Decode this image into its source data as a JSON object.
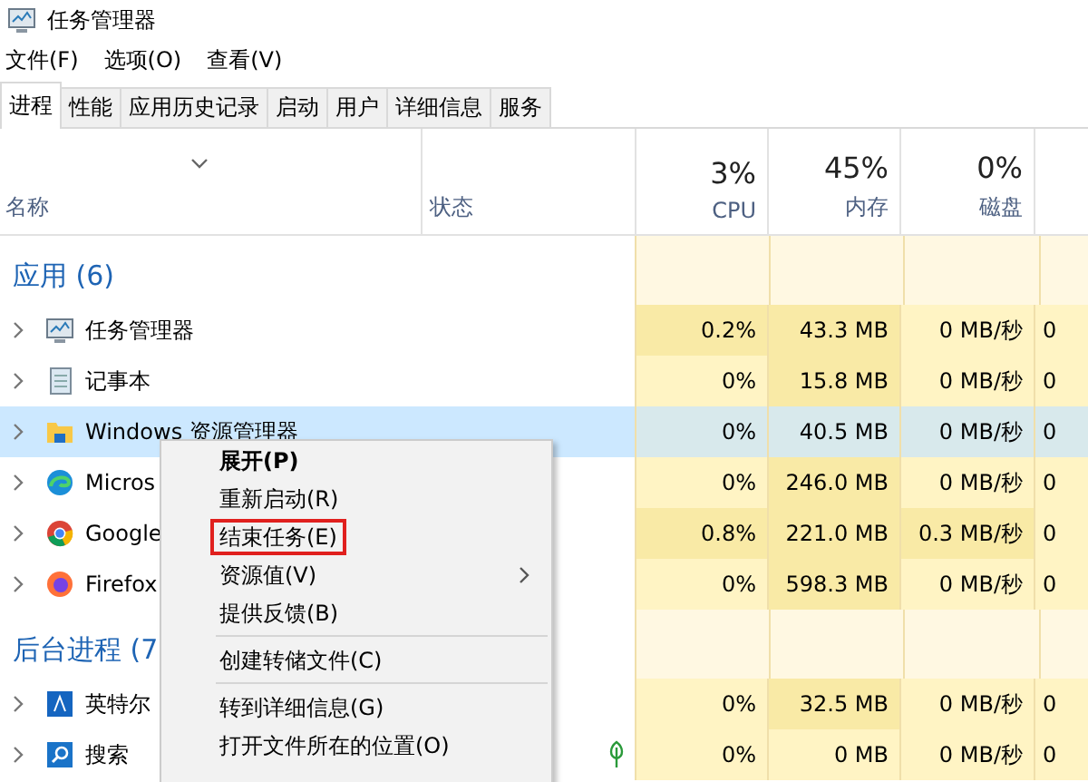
{
  "window": {
    "title": "任务管理器"
  },
  "menu": [
    "文件(F)",
    "选项(O)",
    "查看(V)"
  ],
  "tabs": [
    {
      "label": "进程",
      "selected": true
    },
    {
      "label": "性能",
      "selected": false
    },
    {
      "label": "应用历史记录",
      "selected": false
    },
    {
      "label": "启动",
      "selected": false
    },
    {
      "label": "用户",
      "selected": false
    },
    {
      "label": "详细信息",
      "selected": false
    },
    {
      "label": "服务",
      "selected": false
    }
  ],
  "columns": [
    {
      "label": "名称"
    },
    {
      "label": "状态"
    },
    {
      "percent": "3%",
      "label": "CPU"
    },
    {
      "percent": "45%",
      "label": "内存"
    },
    {
      "percent": "0%",
      "label": "磁盘"
    }
  ],
  "groups": [
    {
      "label": "应用 (6)",
      "rows": [
        {
          "name": "任务管理器",
          "selected": false,
          "eco": false,
          "cells": [
            {
              "text": "0.2%",
              "hot": true
            },
            {
              "text": "43.3 MB",
              "hot": true
            },
            {
              "text": "0 MB/秒",
              "hot": false
            },
            {
              "text": "0",
              "hot": false
            }
          ]
        },
        {
          "name": "记事本",
          "selected": false,
          "eco": false,
          "cells": [
            {
              "text": "0%",
              "hot": false
            },
            {
              "text": "15.8 MB",
              "hot": true
            },
            {
              "text": "0 MB/秒",
              "hot": false
            },
            {
              "text": "0",
              "hot": false
            }
          ]
        },
        {
          "name": "Windows 资源管理器",
          "selected": true,
          "eco": false,
          "cells": [
            {
              "text": "0%",
              "hot": false
            },
            {
              "text": "40.5 MB",
              "hot": false
            },
            {
              "text": "0 MB/秒",
              "hot": false
            },
            {
              "text": "0",
              "hot": false
            }
          ]
        },
        {
          "name": "Micros",
          "selected": false,
          "eco": false,
          "cells": [
            {
              "text": "0%",
              "hot": false
            },
            {
              "text": "246.0 MB",
              "hot": true
            },
            {
              "text": "0 MB/秒",
              "hot": false
            },
            {
              "text": "0",
              "hot": false
            }
          ]
        },
        {
          "name": "Google",
          "selected": false,
          "eco": false,
          "cells": [
            {
              "text": "0.8%",
              "hot": true
            },
            {
              "text": "221.0 MB",
              "hot": true
            },
            {
              "text": "0.3 MB/秒",
              "hot": true
            },
            {
              "text": "0",
              "hot": false
            }
          ]
        },
        {
          "name": "Firefox",
          "selected": false,
          "eco": false,
          "cells": [
            {
              "text": "0%",
              "hot": false
            },
            {
              "text": "598.3 MB",
              "hot": true
            },
            {
              "text": "0 MB/秒",
              "hot": false
            },
            {
              "text": "0",
              "hot": false
            }
          ]
        }
      ]
    },
    {
      "label": "后台进程 (7",
      "rows": [
        {
          "name": "英特尔",
          "selected": false,
          "eco": false,
          "cells": [
            {
              "text": "0%",
              "hot": false
            },
            {
              "text": "32.5 MB",
              "hot": true
            },
            {
              "text": "0 MB/秒",
              "hot": false
            },
            {
              "text": "0",
              "hot": false
            }
          ]
        },
        {
          "name": "搜索",
          "selected": false,
          "eco": true,
          "cells": [
            {
              "text": "0%",
              "hot": false
            },
            {
              "text": "0 MB",
              "hot": false
            },
            {
              "text": "0 MB/秒",
              "hot": false
            },
            {
              "text": "0",
              "hot": false
            }
          ]
        }
      ]
    }
  ],
  "context_menu": [
    {
      "kind": "item",
      "label": "展开(P)",
      "bold": true,
      "outlined": false,
      "submenu": false
    },
    {
      "kind": "item",
      "label": "重新启动(R)",
      "bold": false,
      "outlined": false,
      "submenu": false
    },
    {
      "kind": "item",
      "label": "结束任务(E)",
      "bold": false,
      "outlined": true,
      "submenu": false
    },
    {
      "kind": "item",
      "label": "资源值(V)",
      "bold": false,
      "outlined": false,
      "submenu": true
    },
    {
      "kind": "item",
      "label": "提供反馈(B)",
      "bold": false,
      "outlined": false,
      "submenu": false
    },
    {
      "kind": "separator"
    },
    {
      "kind": "item",
      "label": "创建转储文件(C)",
      "bold": false,
      "outlined": false,
      "submenu": false
    },
    {
      "kind": "separator"
    },
    {
      "kind": "item",
      "label": "转到详细信息(G)",
      "bold": false,
      "outlined": false,
      "submenu": false
    },
    {
      "kind": "item",
      "label": "打开文件所在的位置(O)",
      "bold": false,
      "outlined": false,
      "submenu": false
    }
  ]
}
